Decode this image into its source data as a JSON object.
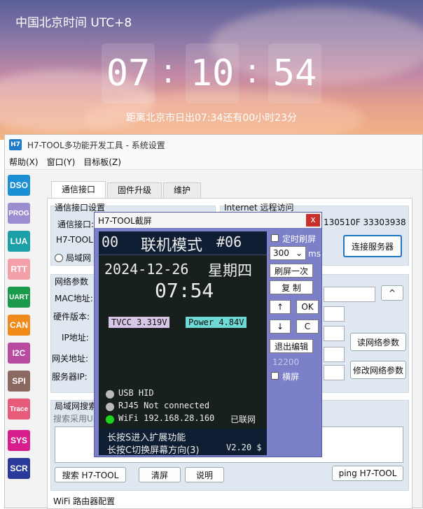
{
  "clock": {
    "title": "中国北京时间 UTC+8",
    "hour": "07",
    "minute": "10",
    "second": "54",
    "colon": ":",
    "sunrise": "距离北京市日出07:34还有00小时23分"
  },
  "window": {
    "logo": "H7",
    "title": "H7-TOOL多功能开发工具 - 系统设置",
    "menu": [
      "帮助(X)",
      "窗口(Y)",
      "目标板(Z)"
    ]
  },
  "sidebar": [
    {
      "label": "DSO",
      "color": "#1b8fd6"
    },
    {
      "label": "PROG",
      "color": "#9c8cd0"
    },
    {
      "label": "LUA",
      "color": "#1aa0a6"
    },
    {
      "label": "RTT",
      "color": "#f3a0a8"
    },
    {
      "label": "UART",
      "color": "#1a9a4a"
    },
    {
      "label": "CAN",
      "color": "#f08a1a"
    },
    {
      "label": "I2C",
      "color": "#b84aa0"
    },
    {
      "label": "SPI",
      "color": "#8a6a60"
    },
    {
      "label": "Trace",
      "color": "#e85a7a"
    },
    {
      "label": "SYS",
      "color": "#d81e8c"
    },
    {
      "label": "SCR",
      "color": "#2a3a9a"
    }
  ],
  "tabs": [
    "通信接口",
    "固件升级",
    "维护"
  ],
  "comm": {
    "group_label": "通信接口设置",
    "port_label": "通信接口:",
    "tool_label": "H7-TOOL",
    "lan_radio": "局域网",
    "remote_group": "Internet 远程访问",
    "remote_id": "130510F 33303938",
    "connect_btn": "连接服务器"
  },
  "net": {
    "group_label": "网络参数（",
    "mac_label": "MAC地址:",
    "hw_label": "硬件版本:",
    "ip_label": "IP地址:",
    "gw_label": "网关地址:",
    "dns_label": "服务器IP:",
    "expand_btn": "^",
    "read_btn": "读网络参数",
    "modify_btn": "修改网络参数"
  },
  "search": {
    "group_label": "局域网搜索",
    "hint": "搜索采用UD",
    "search_btn": "搜索 H7-TOOL",
    "clear_btn": "清屏",
    "help_btn": "说明",
    "ping_btn": "ping H7-TOOL"
  },
  "wifi_group": "WiFi 路由器配置",
  "popup": {
    "title": "H7-TOOL截屏",
    "close": "x",
    "screen": {
      "num": "00",
      "mode": "联机模式",
      "code": "#06",
      "date": "2024-12-26",
      "weekday": "星期四",
      "time": "07:54",
      "tvcc": "TVCC 3.319V",
      "power": "Power 4.84V",
      "usb": "USB HID",
      "rj45": "RJ45 Not connected",
      "wifi": "WiFi 192.168.28.160",
      "wifi_status": "已联网",
      "hint1": "长按S进入扩展功能",
      "hint2": "长按C切换屏幕方向(3)",
      "version": "V2.20 $"
    },
    "timer_label": "定时刷屏",
    "interval": "300",
    "interval_unit": "ms",
    "refresh_btn": "刷屏一次",
    "copy_btn": "复 制",
    "up_btn": "↑",
    "ok_btn": "OK",
    "down_btn": "↓",
    "c_btn": "C",
    "exit_btn": "退出编辑",
    "port_value": "12200",
    "landscape_label": "横屏"
  }
}
